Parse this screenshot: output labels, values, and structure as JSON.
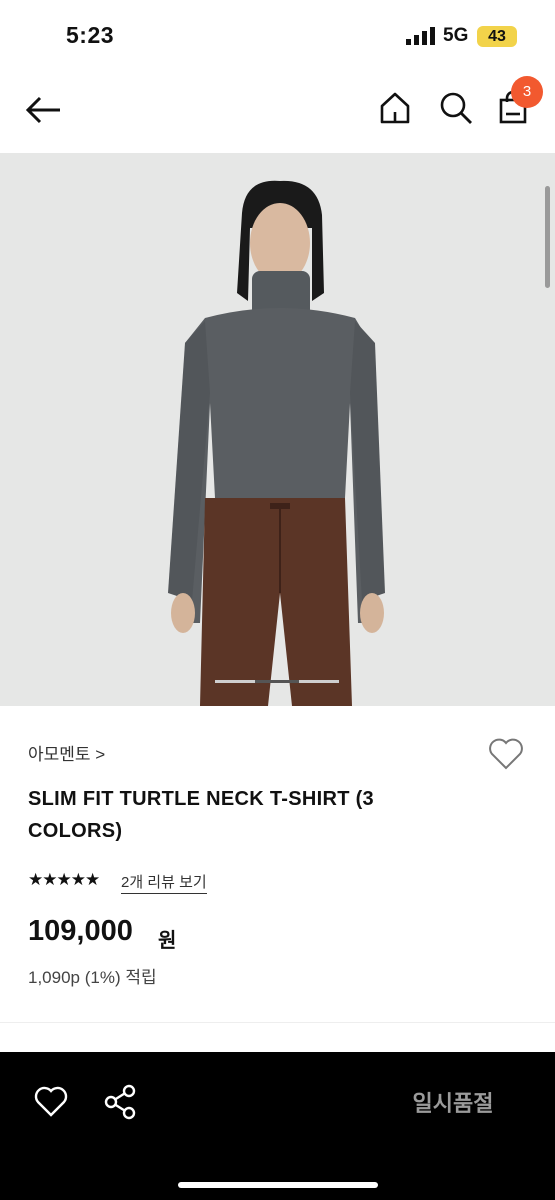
{
  "status_bar": {
    "time": "5:23",
    "network": "5G",
    "battery": "43"
  },
  "nav": {
    "cart_count": "3",
    "icons": [
      "back-arrow-icon",
      "home-icon",
      "search-icon",
      "shopping-bag-icon"
    ]
  },
  "product": {
    "brand": "아모멘토 >",
    "title": "SLIM FIT TURTLE NECK T-SHIRT (3 COLORS)",
    "stars": "★★★★★",
    "reviews": "2개 리뷰 보기",
    "price": "109,000",
    "price_unit": "원",
    "points": "1,090p (1%) 적립"
  },
  "bottom_bar": {
    "soldout_label": "일시품절"
  },
  "colors": {
    "accent": "#f2592f",
    "battery": "#f2d34a",
    "bottom_bar": "#000000",
    "soldout_text": "#9b9b9b"
  }
}
